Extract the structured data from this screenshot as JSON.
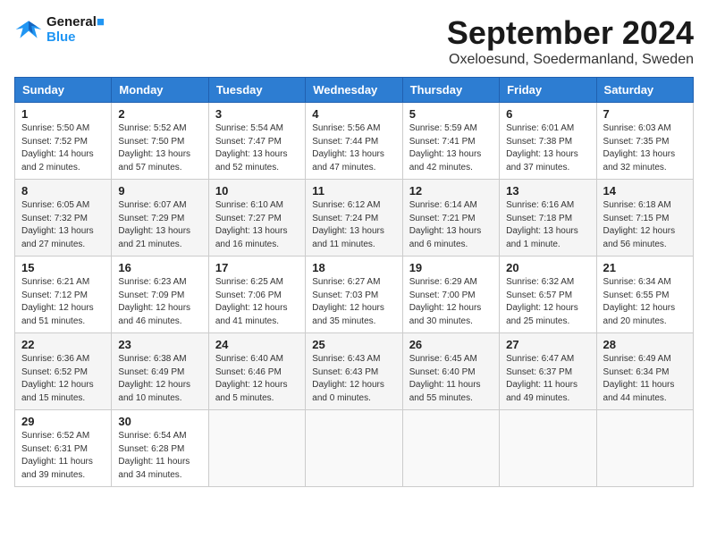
{
  "header": {
    "logo_line1": "General",
    "logo_line2": "Blue",
    "month": "September 2024",
    "location": "Oxeloesund, Soedermanland, Sweden"
  },
  "days_of_week": [
    "Sunday",
    "Monday",
    "Tuesday",
    "Wednesday",
    "Thursday",
    "Friday",
    "Saturday"
  ],
  "weeks": [
    [
      {
        "day": 1,
        "info": "Sunrise: 5:50 AM\nSunset: 7:52 PM\nDaylight: 14 hours\nand 2 minutes."
      },
      {
        "day": 2,
        "info": "Sunrise: 5:52 AM\nSunset: 7:50 PM\nDaylight: 13 hours\nand 57 minutes."
      },
      {
        "day": 3,
        "info": "Sunrise: 5:54 AM\nSunset: 7:47 PM\nDaylight: 13 hours\nand 52 minutes."
      },
      {
        "day": 4,
        "info": "Sunrise: 5:56 AM\nSunset: 7:44 PM\nDaylight: 13 hours\nand 47 minutes."
      },
      {
        "day": 5,
        "info": "Sunrise: 5:59 AM\nSunset: 7:41 PM\nDaylight: 13 hours\nand 42 minutes."
      },
      {
        "day": 6,
        "info": "Sunrise: 6:01 AM\nSunset: 7:38 PM\nDaylight: 13 hours\nand 37 minutes."
      },
      {
        "day": 7,
        "info": "Sunrise: 6:03 AM\nSunset: 7:35 PM\nDaylight: 13 hours\nand 32 minutes."
      }
    ],
    [
      {
        "day": 8,
        "info": "Sunrise: 6:05 AM\nSunset: 7:32 PM\nDaylight: 13 hours\nand 27 minutes."
      },
      {
        "day": 9,
        "info": "Sunrise: 6:07 AM\nSunset: 7:29 PM\nDaylight: 13 hours\nand 21 minutes."
      },
      {
        "day": 10,
        "info": "Sunrise: 6:10 AM\nSunset: 7:27 PM\nDaylight: 13 hours\nand 16 minutes."
      },
      {
        "day": 11,
        "info": "Sunrise: 6:12 AM\nSunset: 7:24 PM\nDaylight: 13 hours\nand 11 minutes."
      },
      {
        "day": 12,
        "info": "Sunrise: 6:14 AM\nSunset: 7:21 PM\nDaylight: 13 hours\nand 6 minutes."
      },
      {
        "day": 13,
        "info": "Sunrise: 6:16 AM\nSunset: 7:18 PM\nDaylight: 13 hours\nand 1 minute."
      },
      {
        "day": 14,
        "info": "Sunrise: 6:18 AM\nSunset: 7:15 PM\nDaylight: 12 hours\nand 56 minutes."
      }
    ],
    [
      {
        "day": 15,
        "info": "Sunrise: 6:21 AM\nSunset: 7:12 PM\nDaylight: 12 hours\nand 51 minutes."
      },
      {
        "day": 16,
        "info": "Sunrise: 6:23 AM\nSunset: 7:09 PM\nDaylight: 12 hours\nand 46 minutes."
      },
      {
        "day": 17,
        "info": "Sunrise: 6:25 AM\nSunset: 7:06 PM\nDaylight: 12 hours\nand 41 minutes."
      },
      {
        "day": 18,
        "info": "Sunrise: 6:27 AM\nSunset: 7:03 PM\nDaylight: 12 hours\nand 35 minutes."
      },
      {
        "day": 19,
        "info": "Sunrise: 6:29 AM\nSunset: 7:00 PM\nDaylight: 12 hours\nand 30 minutes."
      },
      {
        "day": 20,
        "info": "Sunrise: 6:32 AM\nSunset: 6:57 PM\nDaylight: 12 hours\nand 25 minutes."
      },
      {
        "day": 21,
        "info": "Sunrise: 6:34 AM\nSunset: 6:55 PM\nDaylight: 12 hours\nand 20 minutes."
      }
    ],
    [
      {
        "day": 22,
        "info": "Sunrise: 6:36 AM\nSunset: 6:52 PM\nDaylight: 12 hours\nand 15 minutes."
      },
      {
        "day": 23,
        "info": "Sunrise: 6:38 AM\nSunset: 6:49 PM\nDaylight: 12 hours\nand 10 minutes."
      },
      {
        "day": 24,
        "info": "Sunrise: 6:40 AM\nSunset: 6:46 PM\nDaylight: 12 hours\nand 5 minutes."
      },
      {
        "day": 25,
        "info": "Sunrise: 6:43 AM\nSunset: 6:43 PM\nDaylight: 12 hours\nand 0 minutes."
      },
      {
        "day": 26,
        "info": "Sunrise: 6:45 AM\nSunset: 6:40 PM\nDaylight: 11 hours\nand 55 minutes."
      },
      {
        "day": 27,
        "info": "Sunrise: 6:47 AM\nSunset: 6:37 PM\nDaylight: 11 hours\nand 49 minutes."
      },
      {
        "day": 28,
        "info": "Sunrise: 6:49 AM\nSunset: 6:34 PM\nDaylight: 11 hours\nand 44 minutes."
      }
    ],
    [
      {
        "day": 29,
        "info": "Sunrise: 6:52 AM\nSunset: 6:31 PM\nDaylight: 11 hours\nand 39 minutes."
      },
      {
        "day": 30,
        "info": "Sunrise: 6:54 AM\nSunset: 6:28 PM\nDaylight: 11 hours\nand 34 minutes."
      },
      {
        "day": null,
        "info": ""
      },
      {
        "day": null,
        "info": ""
      },
      {
        "day": null,
        "info": ""
      },
      {
        "day": null,
        "info": ""
      },
      {
        "day": null,
        "info": ""
      }
    ]
  ]
}
